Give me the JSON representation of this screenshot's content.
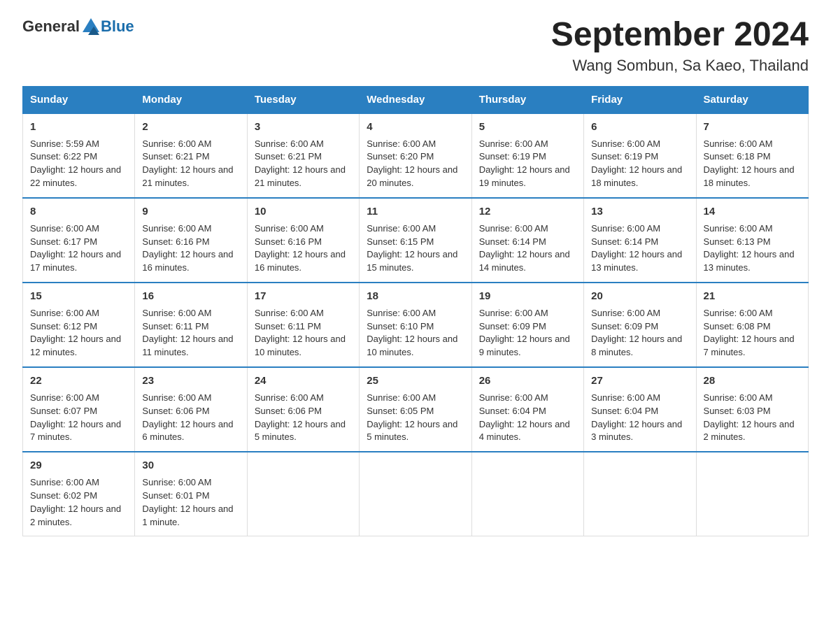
{
  "header": {
    "logo_general": "General",
    "logo_blue": "Blue",
    "month": "September 2024",
    "location": "Wang Sombun, Sa Kaeo, Thailand"
  },
  "days_of_week": [
    "Sunday",
    "Monday",
    "Tuesday",
    "Wednesday",
    "Thursday",
    "Friday",
    "Saturday"
  ],
  "weeks": [
    [
      {
        "day": "1",
        "sunrise": "Sunrise: 5:59 AM",
        "sunset": "Sunset: 6:22 PM",
        "daylight": "Daylight: 12 hours and 22 minutes."
      },
      {
        "day": "2",
        "sunrise": "Sunrise: 6:00 AM",
        "sunset": "Sunset: 6:21 PM",
        "daylight": "Daylight: 12 hours and 21 minutes."
      },
      {
        "day": "3",
        "sunrise": "Sunrise: 6:00 AM",
        "sunset": "Sunset: 6:21 PM",
        "daylight": "Daylight: 12 hours and 21 minutes."
      },
      {
        "day": "4",
        "sunrise": "Sunrise: 6:00 AM",
        "sunset": "Sunset: 6:20 PM",
        "daylight": "Daylight: 12 hours and 20 minutes."
      },
      {
        "day": "5",
        "sunrise": "Sunrise: 6:00 AM",
        "sunset": "Sunset: 6:19 PM",
        "daylight": "Daylight: 12 hours and 19 minutes."
      },
      {
        "day": "6",
        "sunrise": "Sunrise: 6:00 AM",
        "sunset": "Sunset: 6:19 PM",
        "daylight": "Daylight: 12 hours and 18 minutes."
      },
      {
        "day": "7",
        "sunrise": "Sunrise: 6:00 AM",
        "sunset": "Sunset: 6:18 PM",
        "daylight": "Daylight: 12 hours and 18 minutes."
      }
    ],
    [
      {
        "day": "8",
        "sunrise": "Sunrise: 6:00 AM",
        "sunset": "Sunset: 6:17 PM",
        "daylight": "Daylight: 12 hours and 17 minutes."
      },
      {
        "day": "9",
        "sunrise": "Sunrise: 6:00 AM",
        "sunset": "Sunset: 6:16 PM",
        "daylight": "Daylight: 12 hours and 16 minutes."
      },
      {
        "day": "10",
        "sunrise": "Sunrise: 6:00 AM",
        "sunset": "Sunset: 6:16 PM",
        "daylight": "Daylight: 12 hours and 16 minutes."
      },
      {
        "day": "11",
        "sunrise": "Sunrise: 6:00 AM",
        "sunset": "Sunset: 6:15 PM",
        "daylight": "Daylight: 12 hours and 15 minutes."
      },
      {
        "day": "12",
        "sunrise": "Sunrise: 6:00 AM",
        "sunset": "Sunset: 6:14 PM",
        "daylight": "Daylight: 12 hours and 14 minutes."
      },
      {
        "day": "13",
        "sunrise": "Sunrise: 6:00 AM",
        "sunset": "Sunset: 6:14 PM",
        "daylight": "Daylight: 12 hours and 13 minutes."
      },
      {
        "day": "14",
        "sunrise": "Sunrise: 6:00 AM",
        "sunset": "Sunset: 6:13 PM",
        "daylight": "Daylight: 12 hours and 13 minutes."
      }
    ],
    [
      {
        "day": "15",
        "sunrise": "Sunrise: 6:00 AM",
        "sunset": "Sunset: 6:12 PM",
        "daylight": "Daylight: 12 hours and 12 minutes."
      },
      {
        "day": "16",
        "sunrise": "Sunrise: 6:00 AM",
        "sunset": "Sunset: 6:11 PM",
        "daylight": "Daylight: 12 hours and 11 minutes."
      },
      {
        "day": "17",
        "sunrise": "Sunrise: 6:00 AM",
        "sunset": "Sunset: 6:11 PM",
        "daylight": "Daylight: 12 hours and 10 minutes."
      },
      {
        "day": "18",
        "sunrise": "Sunrise: 6:00 AM",
        "sunset": "Sunset: 6:10 PM",
        "daylight": "Daylight: 12 hours and 10 minutes."
      },
      {
        "day": "19",
        "sunrise": "Sunrise: 6:00 AM",
        "sunset": "Sunset: 6:09 PM",
        "daylight": "Daylight: 12 hours and 9 minutes."
      },
      {
        "day": "20",
        "sunrise": "Sunrise: 6:00 AM",
        "sunset": "Sunset: 6:09 PM",
        "daylight": "Daylight: 12 hours and 8 minutes."
      },
      {
        "day": "21",
        "sunrise": "Sunrise: 6:00 AM",
        "sunset": "Sunset: 6:08 PM",
        "daylight": "Daylight: 12 hours and 7 minutes."
      }
    ],
    [
      {
        "day": "22",
        "sunrise": "Sunrise: 6:00 AM",
        "sunset": "Sunset: 6:07 PM",
        "daylight": "Daylight: 12 hours and 7 minutes."
      },
      {
        "day": "23",
        "sunrise": "Sunrise: 6:00 AM",
        "sunset": "Sunset: 6:06 PM",
        "daylight": "Daylight: 12 hours and 6 minutes."
      },
      {
        "day": "24",
        "sunrise": "Sunrise: 6:00 AM",
        "sunset": "Sunset: 6:06 PM",
        "daylight": "Daylight: 12 hours and 5 minutes."
      },
      {
        "day": "25",
        "sunrise": "Sunrise: 6:00 AM",
        "sunset": "Sunset: 6:05 PM",
        "daylight": "Daylight: 12 hours and 5 minutes."
      },
      {
        "day": "26",
        "sunrise": "Sunrise: 6:00 AM",
        "sunset": "Sunset: 6:04 PM",
        "daylight": "Daylight: 12 hours and 4 minutes."
      },
      {
        "day": "27",
        "sunrise": "Sunrise: 6:00 AM",
        "sunset": "Sunset: 6:04 PM",
        "daylight": "Daylight: 12 hours and 3 minutes."
      },
      {
        "day": "28",
        "sunrise": "Sunrise: 6:00 AM",
        "sunset": "Sunset: 6:03 PM",
        "daylight": "Daylight: 12 hours and 2 minutes."
      }
    ],
    [
      {
        "day": "29",
        "sunrise": "Sunrise: 6:00 AM",
        "sunset": "Sunset: 6:02 PM",
        "daylight": "Daylight: 12 hours and 2 minutes."
      },
      {
        "day": "30",
        "sunrise": "Sunrise: 6:00 AM",
        "sunset": "Sunset: 6:01 PM",
        "daylight": "Daylight: 12 hours and 1 minute."
      },
      null,
      null,
      null,
      null,
      null
    ]
  ]
}
